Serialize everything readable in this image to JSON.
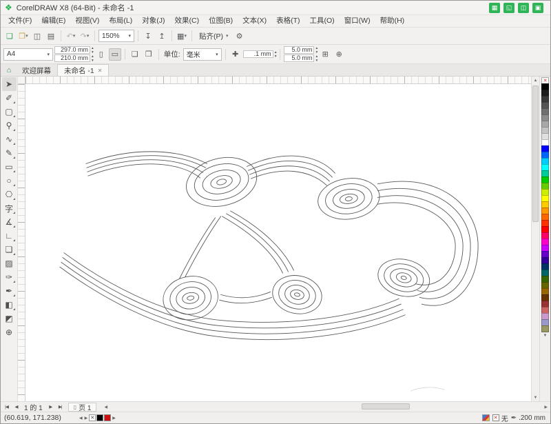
{
  "colors": {
    "accent_green": "#22b24c",
    "chrome": "#f2f1f0",
    "canvas": "#ffffff"
  },
  "title_bar": {
    "title": "CorelDRAW X8 (64-Bit) - 未命名 -1",
    "buttons": [
      {
        "name": "store",
        "glyph": "▦"
      },
      {
        "name": "fullscreen",
        "glyph": "◱"
      },
      {
        "name": "save-cloud",
        "glyph": "◫"
      },
      {
        "name": "workspace",
        "glyph": "▣"
      }
    ]
  },
  "menu": {
    "items": [
      {
        "name": "file",
        "label": "文件(F)"
      },
      {
        "name": "edit",
        "label": "编辑(E)"
      },
      {
        "name": "view",
        "label": "视图(V)"
      },
      {
        "name": "layout",
        "label": "布局(L)"
      },
      {
        "name": "object",
        "label": "对象(J)"
      },
      {
        "name": "effects",
        "label": "效果(C)"
      },
      {
        "name": "bitmaps",
        "label": "位图(B)"
      },
      {
        "name": "text",
        "label": "文本(X)"
      },
      {
        "name": "table",
        "label": "表格(T)"
      },
      {
        "name": "tools",
        "label": "工具(O)"
      },
      {
        "name": "window",
        "label": "窗口(W)"
      },
      {
        "name": "help",
        "label": "帮助(H)"
      }
    ]
  },
  "toolbar": {
    "zoom_value": "150%",
    "snap_label": "贴齐(P)"
  },
  "property_bar": {
    "page_size": "A4",
    "page_width": "297.0 mm",
    "page_height": "210.0 mm",
    "units_label": "单位:",
    "units_value": "毫米",
    "nudge_value": ".1 mm",
    "duplicate_x": "5.0 mm",
    "duplicate_y": "5.0 mm"
  },
  "tabs": {
    "welcome": "欢迎屏幕",
    "document": "未命名 -1"
  },
  "toolbox": {
    "tools": [
      {
        "name": "pick-tool",
        "glyph": "➤",
        "active": true
      },
      {
        "name": "shape-tool",
        "glyph": "✐",
        "f": true
      },
      {
        "name": "crop-tool",
        "glyph": "▢",
        "f": true
      },
      {
        "name": "zoom-tool",
        "glyph": "⚲",
        "f": true
      },
      {
        "name": "freehand-tool",
        "glyph": "∿",
        "f": true
      },
      {
        "name": "artistic-media-tool",
        "glyph": "✎",
        "f": true
      },
      {
        "name": "rectangle-tool",
        "glyph": "▭",
        "f": true
      },
      {
        "name": "ellipse-tool",
        "glyph": "○",
        "f": true
      },
      {
        "name": "polygon-tool",
        "glyph": "⎔",
        "f": true
      },
      {
        "name": "text-tool",
        "glyph": "字",
        "f": true
      },
      {
        "name": "parallel-dimension-tool",
        "glyph": "∡",
        "f": true
      },
      {
        "name": "connector-tool",
        "glyph": "∟",
        "f": true
      },
      {
        "name": "drop-shadow-tool",
        "glyph": "❏",
        "f": true
      },
      {
        "name": "transparency-tool",
        "glyph": "▨"
      },
      {
        "name": "color-eyedropper-tool",
        "glyph": "✑",
        "f": true
      },
      {
        "name": "outline-pen-tool",
        "glyph": "✒",
        "f": true
      },
      {
        "name": "interactive-fill-tool",
        "glyph": "◧",
        "f": true
      },
      {
        "name": "smart-fill-tool",
        "glyph": "◩"
      },
      {
        "name": "more-tools",
        "glyph": "⊕"
      }
    ]
  },
  "palette": {
    "colors": [
      "#000000",
      "#1c1c1c",
      "#383838",
      "#545454",
      "#707070",
      "#8c8c8c",
      "#a8a8a8",
      "#c4c4c4",
      "#e0e0e0",
      "#ffffff",
      "#0000ff",
      "#0066ff",
      "#00ccff",
      "#00ffff",
      "#00cc99",
      "#00cc00",
      "#66cc00",
      "#ccee00",
      "#ffff00",
      "#ffcc00",
      "#ff9900",
      "#ff6600",
      "#ff3300",
      "#ff0000",
      "#ff0066",
      "#ff00cc",
      "#cc00ff",
      "#6600cc",
      "#330099",
      "#003366",
      "#006666",
      "#336600",
      "#666600",
      "#996600",
      "#663300",
      "#993333",
      "#cc6666",
      "#cc99cc",
      "#9999cc",
      "#999966"
    ]
  },
  "pages": {
    "counter": "1 的 1",
    "page_tab": "页 1"
  },
  "document_palette": {
    "colors": [
      "#000000",
      "#cc1111"
    ]
  },
  "status": {
    "coordinates": "(60.619, 171.238)",
    "fill_value": "无",
    "outline_value": ".200 mm"
  },
  "icons": {
    "logo": "❖",
    "new_document": "❏",
    "open_folder": "❐",
    "save": "◫",
    "print": "▤",
    "undo": "↶",
    "redo": "↷",
    "import": "↧",
    "export": "↥",
    "launcher": "▦",
    "gear": "⚙",
    "dropdown": "▾",
    "spin_up": "▴",
    "spin_down": "▾",
    "portrait": "▯",
    "landscape": "▭",
    "page_current": "❑",
    "page_all": "❒",
    "nudge": "✚",
    "duplicate_distance": "⊞",
    "add_circle": "⊕",
    "home": "⌂",
    "close": "✕",
    "first": "|◀",
    "prev": "◀",
    "next": "▶",
    "last": "▶|",
    "up": "▲",
    "down": "▼",
    "left": "◀",
    "right": "▶",
    "page": "▯",
    "no_color": "✕",
    "fill_none": "✕",
    "outline_pen": "✒"
  }
}
